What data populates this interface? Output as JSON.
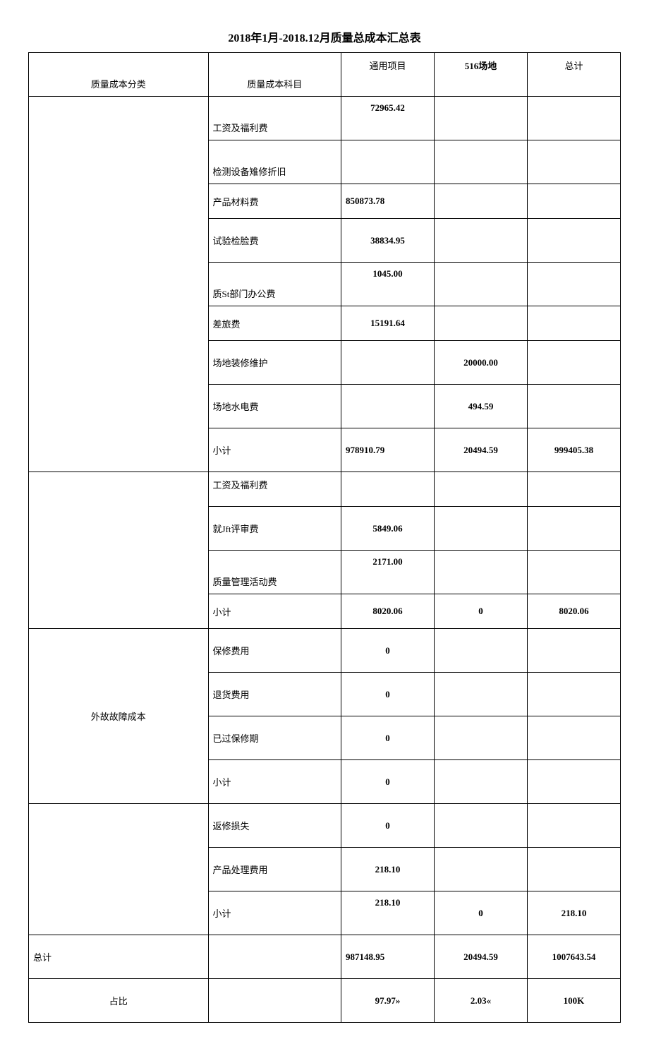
{
  "title": "2018年1月-2018.12月质量总成本汇总表",
  "headers": {
    "cat": "质量成本分类",
    "subj": "质量成本科目",
    "c1": "通用项目",
    "c2": "516场地",
    "c3": "总计"
  },
  "section1": {
    "r0": {
      "subj": "工资及福利费",
      "c1": "72965.42"
    },
    "r1": {
      "subj": "检测设备雉修折旧"
    },
    "r2": {
      "subj": "产品材料费",
      "c1": "850873.78"
    },
    "r3": {
      "subj": "试验检脸费",
      "c1": "38834.95"
    },
    "r4": {
      "subj": "质St部门办公费",
      "c1": "1045.00"
    },
    "r5": {
      "subj": "差旅费",
      "c1": "15191.64"
    },
    "r6": {
      "subj": "场地装修维护",
      "c2": "20000.00"
    },
    "r7": {
      "subj": "场地水电费",
      "c2": "494.59"
    },
    "r8": {
      "subj": "小计",
      "c1": "978910.79",
      "c2": "20494.59",
      "c3": "999405.38"
    }
  },
  "section2": {
    "r0": {
      "subj": "工资及福利费"
    },
    "r1": {
      "subj": "就Jft评审费",
      "c1": "5849.06"
    },
    "r2": {
      "subj": "质量管理活动费",
      "c1": "2171.00"
    },
    "r3": {
      "subj": "小计",
      "c1": "8020.06",
      "c2": "0",
      "c3": "8020.06"
    }
  },
  "section3": {
    "cat": "外故故障成本",
    "r0": {
      "subj": "保修费用",
      "c1": "0"
    },
    "r1": {
      "subj": "退货费用",
      "c1": "0"
    },
    "r2": {
      "subj": "已过保修期",
      "c1": "0"
    },
    "r3": {
      "subj": "小计",
      "c1": "0"
    }
  },
  "section4": {
    "r0": {
      "subj": "返修损失",
      "c1": "0"
    },
    "r1": {
      "subj": "产品处理费用",
      "c1": "218.10"
    },
    "r2": {
      "subj": "小计",
      "c1": "218.10",
      "c2": "0",
      "c3": "218.10"
    }
  },
  "totals": {
    "label": "总计",
    "c1": "987148.95",
    "c2": "20494.59",
    "c3": "1007643.54"
  },
  "ratio": {
    "label": "占比",
    "c1": "97.97»",
    "c2": "2.03«",
    "c3": "100K"
  }
}
